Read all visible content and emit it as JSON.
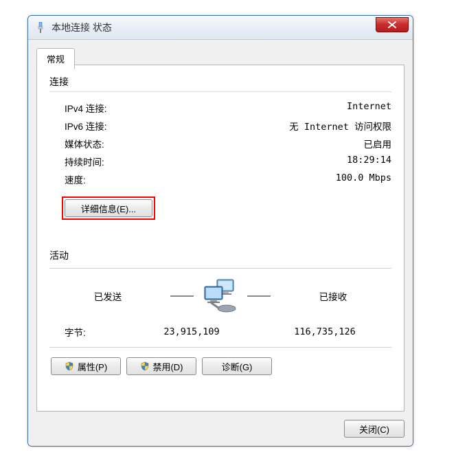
{
  "window": {
    "title": "本地连接 状态"
  },
  "tab": {
    "label": "常规"
  },
  "connection": {
    "section_title": "连接",
    "ipv4_label": "IPv4 连接:",
    "ipv4_value": "Internet",
    "ipv6_label": "IPv6 连接:",
    "ipv6_value": "无 Internet 访问权限",
    "media_label": "媒体状态:",
    "media_value": "已启用",
    "duration_label": "持续时间:",
    "duration_value": "18:29:14",
    "speed_label": "速度:",
    "speed_value": "100.0 Mbps"
  },
  "details_button": "详细信息(E)...",
  "activity": {
    "section_title": "活动",
    "sent_label": "已发送",
    "received_label": "已接收",
    "bytes_label": "字节:",
    "bytes_sent": "23,915,109",
    "bytes_received": "116,735,126"
  },
  "buttons": {
    "properties": "属性(P)",
    "disable": "禁用(D)",
    "diagnose": "诊断(G)",
    "close": "关闭(C)"
  }
}
